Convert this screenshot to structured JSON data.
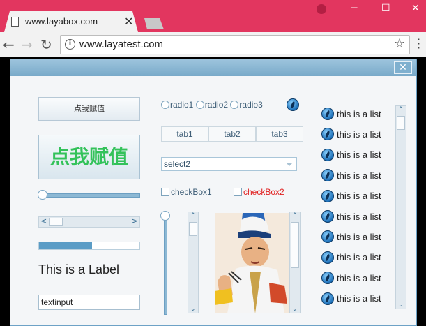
{
  "browser": {
    "tab_title": "www.layabox.com",
    "tab_close": "✕",
    "address": "www.layatest.com",
    "window_controls": {
      "minimize": "─",
      "maximize": "☐",
      "close": "✕"
    }
  },
  "dialog": {
    "close_label": "✕",
    "button_small_label": "点我赋值",
    "button_big_label": "点我赋值",
    "hslider_value": 0,
    "progress_value": 0.53,
    "label_text": "This is a Label",
    "textinput_value": "textinput",
    "radios": [
      "radio1",
      "radio2",
      "radio3"
    ],
    "tabs": [
      "tab1",
      "tab2",
      "tab3"
    ],
    "select_value": "select2",
    "checkbox1_label": "checkBox1",
    "checkbox2_label": "checkBox2",
    "checkbox2_color": "#e02020",
    "list_items": [
      "this is a list",
      "this is a list",
      "this is a list",
      "this is a list",
      "this is a list",
      "this is a list",
      "this is a list",
      "this is a list",
      "this is a list",
      "this is a list"
    ]
  },
  "colors": {
    "titlebar": "#e2365f",
    "accent_green": "#33c25a",
    "dialog_border": "#6da2c6"
  }
}
